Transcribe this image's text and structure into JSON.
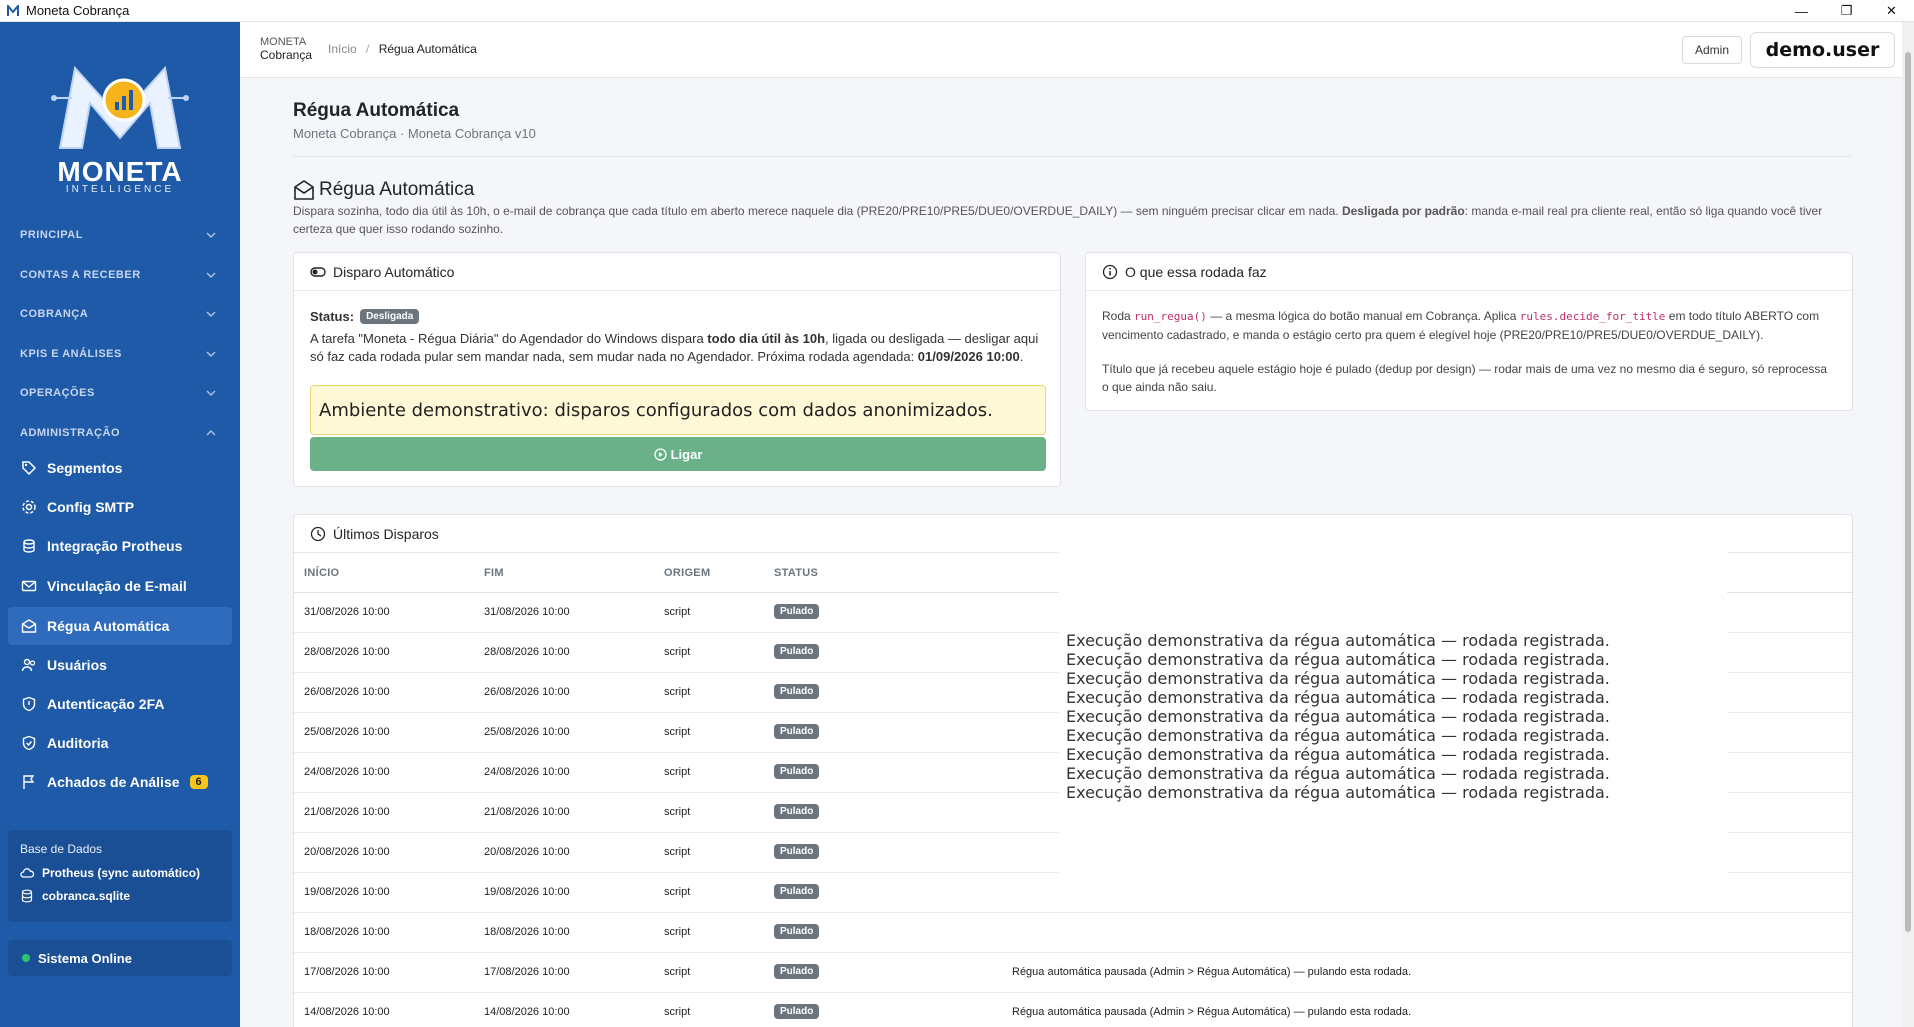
{
  "window": {
    "title": "Moneta Cobrança",
    "controls": [
      "—",
      "❐",
      "✕"
    ]
  },
  "brand": {
    "name": "MONETA",
    "tagline": "INTELLIGENCE",
    "mini_top": "MONETA",
    "mini_bottom": "Cobrança"
  },
  "sidebar": {
    "sections": [
      {
        "label": "PRINCIPAL"
      },
      {
        "label": "CONTAS A RECEBER"
      },
      {
        "label": "COBRANÇA"
      },
      {
        "label": "KPIS E ANÁLISES"
      },
      {
        "label": "OPERAÇÕES"
      },
      {
        "label": "ADMINISTRAÇÃO"
      }
    ],
    "items": [
      {
        "label": "Segmentos",
        "icon": "tag-icon"
      },
      {
        "label": "Config SMTP",
        "icon": "gear-icon"
      },
      {
        "label": "Integração Protheus",
        "icon": "database-icon"
      },
      {
        "label": "Vinculação de E-mail",
        "icon": "mail-link-icon"
      },
      {
        "label": "Régua Automática",
        "icon": "mail-icon",
        "active": true
      },
      {
        "label": "Usuários",
        "icon": "users-icon"
      },
      {
        "label": "Autenticação 2FA",
        "icon": "shield-icon"
      },
      {
        "label": "Auditoria",
        "icon": "shield-check-icon"
      },
      {
        "label": "Achados de Análise",
        "icon": "flag-icon",
        "badge": "6"
      }
    ],
    "db": {
      "title": "Base de Dados",
      "rows": [
        {
          "label": "Protheus (sync automático)",
          "icon": "cloud-icon"
        },
        {
          "label": "cobranca.sqlite",
          "icon": "database-icon"
        }
      ]
    },
    "status": "Sistema Online"
  },
  "header": {
    "breadcrumb": [
      "Início",
      "Régua Automática"
    ],
    "admin_button": "Admin",
    "user": "demo.user"
  },
  "page": {
    "title": "Régua Automática",
    "subtitle": "Moneta Cobrança · Moneta Cobrança v10",
    "section_title": "Régua Automática",
    "description_a": "Dispara sozinha, todo dia útil às 10h, o e-mail de cobrança que cada título em aberto merece naquele dia (PRE20/PRE10/PRE5/DUE0/OVERDUE_DAILY) — sem ninguém precisar clicar em nada. ",
    "description_b": "Desligada por padrão",
    "description_c": ": manda e-mail real pra cliente real, então só liga quando você tiver certeza que quer isso rodando sozinho."
  },
  "trigger_card": {
    "title": "Disparo Automático",
    "status_label": "Status:",
    "status_value": "Desligada",
    "text_a": "A tarefa \"Moneta - Régua Diária\" do Agendador do Windows dispara ",
    "text_b": "todo dia útil às 10h",
    "text_c": ", ligada ou desligada — desligar aqui só faz cada rodada pular sem mandar nada, sem mudar nada no Agendador. Próxima rodada agendada: ",
    "next_run": "01/09/2026 10:00",
    "text_d": ".",
    "demo_note": "Ambiente demonstrativo: disparos configurados com dados anonimizados.",
    "button": "Ligar"
  },
  "info_card": {
    "title": "O que essa rodada faz",
    "p1_a": "Roda ",
    "p1_code1": "run_regua()",
    "p1_b": " — a mesma lógica do botão manual em Cobrança. Aplica ",
    "p1_code2": "rules.decide_for_title",
    "p1_c": " em todo título ABERTO com vencimento cadastrado, e manda o estágio certo pra quem é elegível hoje (PRE20/PRE10/PRE5/DUE0/OVERDUE_DAILY).",
    "p2": "Título que já recebeu aquele estágio hoje é pulado (dedup por design) — rodar mais de uma vez no mesmo dia é seguro, só reprocessa o que ainda não saiu."
  },
  "history": {
    "title": "Últimos Disparos",
    "columns": [
      "INÍCIO",
      "FIM",
      "ORIGEM",
      "STATUS"
    ],
    "rows": [
      {
        "start": "31/08/2026 10:00",
        "end": "31/08/2026 10:00",
        "origin": "script",
        "status": "Pulado",
        "msg": ""
      },
      {
        "start": "28/08/2026 10:00",
        "end": "28/08/2026 10:00",
        "origin": "script",
        "status": "Pulado",
        "msg": ""
      },
      {
        "start": "26/08/2026 10:00",
        "end": "26/08/2026 10:00",
        "origin": "script",
        "status": "Pulado",
        "msg": ""
      },
      {
        "start": "25/08/2026 10:00",
        "end": "25/08/2026 10:00",
        "origin": "script",
        "status": "Pulado",
        "msg": ""
      },
      {
        "start": "24/08/2026 10:00",
        "end": "24/08/2026 10:00",
        "origin": "script",
        "status": "Pulado",
        "msg": ""
      },
      {
        "start": "21/08/2026 10:00",
        "end": "21/08/2026 10:00",
        "origin": "script",
        "status": "Pulado",
        "msg": ""
      },
      {
        "start": "20/08/2026 10:00",
        "end": "20/08/2026 10:00",
        "origin": "script",
        "status": "Pulado",
        "msg": ""
      },
      {
        "start": "19/08/2026 10:00",
        "end": "19/08/2026 10:00",
        "origin": "script",
        "status": "Pulado",
        "msg": ""
      },
      {
        "start": "18/08/2026 10:00",
        "end": "18/08/2026 10:00",
        "origin": "script",
        "status": "Pulado",
        "msg": ""
      },
      {
        "start": "17/08/2026 10:00",
        "end": "17/08/2026 10:00",
        "origin": "script",
        "status": "Pulado",
        "msg": "Régua automática pausada (Admin > Régua Automática) — pulando esta rodada."
      },
      {
        "start": "14/08/2026 10:00",
        "end": "14/08/2026 10:00",
        "origin": "script",
        "status": "Pulado",
        "msg": "Régua automática pausada (Admin > Régua Automática) — pulando esta rodada."
      }
    ],
    "overlay_lines": [
      "Execução demonstrativa da régua automática — rodada registrada.",
      "Execução demonstrativa da régua automática — rodada registrada.",
      "Execução demonstrativa da régua automática — rodada registrada.",
      "Execução demonstrativa da régua automática — rodada registrada.",
      "Execução demonstrativa da régua automática — rodada registrada.",
      "Execução demonstrativa da régua automática — rodada registrada.",
      "Execução demonstrativa da régua automática — rodada registrada.",
      "Execução demonstrativa da régua automática — rodada registrada.",
      "Execução demonstrativa da régua automática — rodada registrada."
    ]
  },
  "colors": {
    "sidebar": "#1e5aa8",
    "active_item": "#2e6bbd",
    "ligar": "#6ab088",
    "badge_gray": "#6c757d",
    "demo_bg": "#fff8d6"
  }
}
